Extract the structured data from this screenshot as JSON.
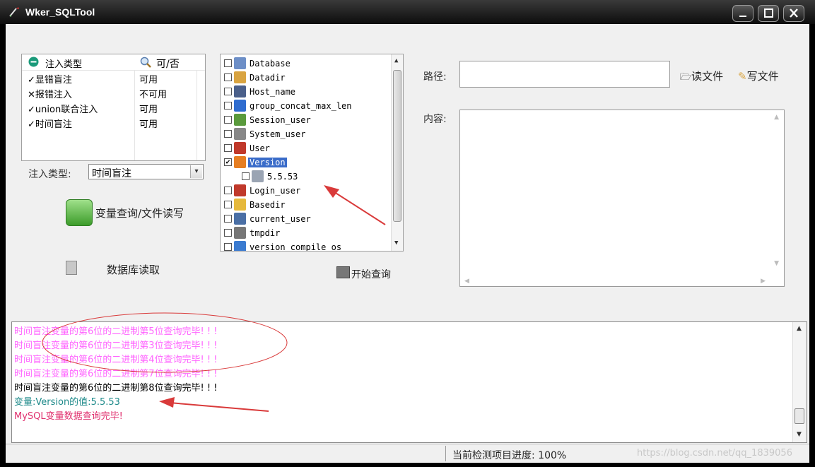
{
  "window": {
    "title": "Wker_SQLTool"
  },
  "inject_grid": {
    "headers": [
      "注入类型",
      "可/否"
    ],
    "rows": [
      {
        "type": "显错盲注",
        "status": "可用",
        "mark": "✓"
      },
      {
        "type": "报错注入",
        "status": "不可用",
        "mark": "✕"
      },
      {
        "type": "union联合注入",
        "status": "可用",
        "mark": "✓"
      },
      {
        "type": "时间盲注",
        "status": "可用",
        "mark": "✓"
      }
    ]
  },
  "inject_select": {
    "label": "注入类型:",
    "value": "时间盲注"
  },
  "buttons": {
    "var_query": "变量查询/文件读写",
    "db_read": "数据库读取",
    "start_query": "开始查询",
    "read_file": "读文件",
    "write_file": "写文件"
  },
  "tree": {
    "items": [
      {
        "label": "Database",
        "checked": false,
        "icon_color": "#6d8fc7"
      },
      {
        "label": "Datadir",
        "checked": false,
        "icon_color": "#d9a441"
      },
      {
        "label": "Host_name",
        "checked": false,
        "icon_color": "#4a5f8a"
      },
      {
        "label": "group_concat_max_len",
        "checked": false,
        "icon_color": "#2f6ccf"
      },
      {
        "label": "Session_user",
        "checked": false,
        "icon_color": "#5a9a3c"
      },
      {
        "label": "System_user",
        "checked": false,
        "icon_color": "#888888"
      },
      {
        "label": "User",
        "checked": false,
        "icon_color": "#c0392b"
      },
      {
        "label": "Version",
        "checked": true,
        "icon_color": "#e67e22",
        "selected": true
      },
      {
        "label": "5.5.53",
        "checked": false,
        "icon_color": "#9aa4b3",
        "child": true
      },
      {
        "label": "Login_user",
        "checked": false,
        "icon_color": "#c0392b"
      },
      {
        "label": "Basedir",
        "checked": false,
        "icon_color": "#e6b93c"
      },
      {
        "label": "current_user",
        "checked": false,
        "icon_color": "#4a6fa5"
      },
      {
        "label": "tmpdir",
        "checked": false,
        "icon_color": "#777777"
      },
      {
        "label": "version_compile_os",
        "checked": false,
        "icon_color": "#3b7bd0"
      }
    ]
  },
  "right_panel": {
    "path_label": "路径:",
    "path_value": "",
    "content_label": "内容:",
    "content_value": ""
  },
  "log": {
    "lines": [
      {
        "text": "时间盲注变量的第6位的二进制第5位查询完毕! ! !",
        "color": "#ff66ff"
      },
      {
        "text": "时间盲注变量的第6位的二进制第3位查询完毕! ! !",
        "color": "#ff66ff"
      },
      {
        "text": "时间盲注变量的第6位的二进制第4位查询完毕! ! !",
        "color": "#ff66ff"
      },
      {
        "text": "时间盲注变量的第6位的二进制第7位查询完毕! ! !",
        "color": "#ff66ff"
      },
      {
        "text": "时间盲注变量的第6位的二进制第8位查询完毕! ! !",
        "color": "#000000"
      },
      {
        "text": "变量:Version的值:5.5.53",
        "color": "#1e8a8a"
      },
      {
        "text": "MySQL变量数据查询完毕!",
        "color": "#e0306e"
      }
    ]
  },
  "status_bar": {
    "progress_text": "当前检测项目进度: 100%",
    "progress_value": 1.0,
    "watermark": "https://blog.csdn.net/qq_1839056"
  },
  "colors": {
    "annotation_red": "#d93a3a",
    "selection_blue": "#3a6cc9"
  }
}
